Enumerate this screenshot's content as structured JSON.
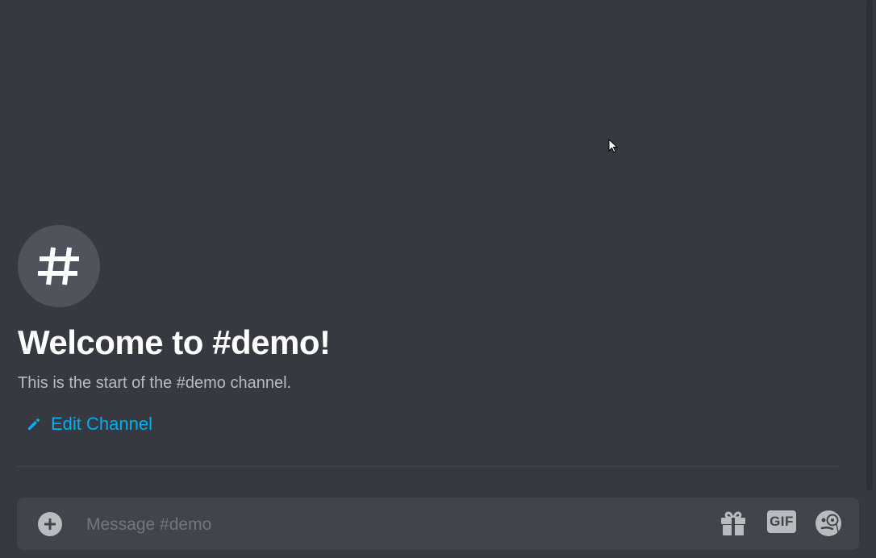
{
  "channel": {
    "hash_symbol": "#",
    "welcome_title": "Welcome to #demo!",
    "welcome_subtitle": "This is the start of the #demo channel.",
    "edit_channel_label": "Edit Channel"
  },
  "composer": {
    "placeholder": "Message #demo",
    "value": "",
    "gif_label": "GIF",
    "icons": {
      "add": "plus-circle-icon",
      "gift": "gift-icon",
      "emoji": "emoji-icon"
    }
  },
  "colors": {
    "background": "#36393f",
    "composer_background": "#40444b",
    "link": "#00aff4",
    "title": "#ffffff",
    "subtitle": "#b9bbbe",
    "icon": "#b9bbbe"
  }
}
